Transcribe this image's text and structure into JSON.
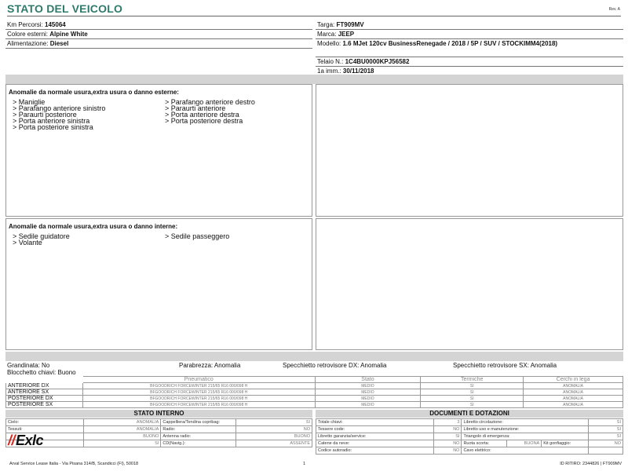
{
  "header": {
    "title": "STATO DEL VEICOLO",
    "rev": "Rev. A"
  },
  "vehicle": {
    "km_label": "Km Percorsi:",
    "km_value": "145064",
    "color_label": "Colore esterni:",
    "color_value": "Alpine White",
    "fuel_label": "Alimentazione:",
    "fuel_value": "Diesel",
    "plate_label": "Targa:",
    "plate_value": "FT909MV",
    "brand_label": "Marca:",
    "brand_value": "JEEP",
    "model_label": "Modello:",
    "model_value": "1.6 MJet 120cv BusinessRenegade / 2018 / 5P / SUV / STOCKIMM4(2018)",
    "chassis_label": "Telaio N.:",
    "chassis_value": "1C4BU0000KPJ56582",
    "registration_label": "1a imm.:",
    "registration_value": "30/11/2018"
  },
  "external_damage": {
    "title": "Anomalie da normale usura,extra usura o danno esterne:",
    "items": [
      "> Maniglie",
      "> Parafango anteriore destro",
      "> Parafango anteriore sinistro",
      "> Paraurti anteriore",
      "> Paraurti posteriore",
      "> Porta anteriore destra",
      "> Porta anteriore sinistra",
      "> Porta posteriore destra",
      "> Porta posteriore sinistra"
    ]
  },
  "internal_damage": {
    "title": "Anomalie da normale usura,extra usura o danno interne:",
    "items": [
      "> Sedile guidatore",
      "> Sedile passeggero",
      "> Volante"
    ]
  },
  "summary": {
    "hail": "Grandinata: No",
    "windshield": "Parabrezza: Anomalia",
    "mirror_dx": "Specchietto retrovisore DX: Anomalia",
    "mirror_sx": "Specchietto retrovisore SX: Anomalia",
    "key_block": "Blocchetto chiavi: Buono"
  },
  "tyres": {
    "headers": [
      "Pneumatico",
      "Stato",
      "Termiche",
      "Cerchi in lega"
    ],
    "rows": [
      {
        "position": "ANTERIORE DX",
        "tyre": "BFGOODRICH FORCEWINTER 215/65 R16 000/098 H",
        "status": "MEDIO",
        "winter": "SI",
        "rims": "ANOMALIA"
      },
      {
        "position": "ANTERIORE SX",
        "tyre": "BFGOODRICH FORCEWINTER 215/65 R16 000/098 H",
        "status": "MEDIO",
        "winter": "SI",
        "rims": "ANOMALIA"
      },
      {
        "position": "POSTERIORE DX",
        "tyre": "BFGOODRICH FORCEWINTER 215/65 R16 000/098 H",
        "status": "MEDIO",
        "winter": "SI",
        "rims": "ANOMALIA"
      },
      {
        "position": "POSTERIORE SX",
        "tyre": "BFGOODRICH FORCEWINTER 215/65 R16 000/098 H",
        "status": "MEDIO",
        "winter": "SI",
        "rims": "ANOMALIA"
      }
    ]
  },
  "internal_state": {
    "title": "STATO INTERNO",
    "rows": [
      [
        "Cielo:",
        "ANOMALIA",
        "Cappelliera/Tendina copribag:",
        "SI"
      ],
      [
        "Tessuti:",
        "ANOMALIA",
        "Radio:",
        "NO"
      ],
      [
        "",
        "BUONO",
        "Antenna radio:",
        "BUONO"
      ],
      [
        "",
        "SI",
        "CD(Navig.):",
        "ASSENTE"
      ]
    ]
  },
  "documents": {
    "title": "DOCUMENTI E DOTAZIONI",
    "rows": [
      [
        "Totale chiavi:",
        "3",
        "Libretto circolazione:",
        "SI"
      ],
      [
        "Tessere code:",
        "NO",
        "Libretto uso e manutenzione:",
        "SI"
      ],
      [
        "Libretto garanzia/service:",
        "SI",
        "Triangolo di emergenza:",
        "SI"
      ],
      [
        "Catene da neve:",
        "NO",
        "Ruota scorta:",
        "BUONA",
        "Kit gonfiaggio:",
        "NO"
      ],
      [
        "Codice autoradio:",
        "NO",
        "Cavo elettrico:",
        ""
      ]
    ]
  },
  "logo": {
    "text": "Exlc"
  },
  "footer": {
    "address": "Arval Service Lease Italia - Via Pisana 314/B, Scandicci (FI), 50018",
    "page": "1",
    "id": "ID RITIRO: 2344826 | FT909MV"
  }
}
